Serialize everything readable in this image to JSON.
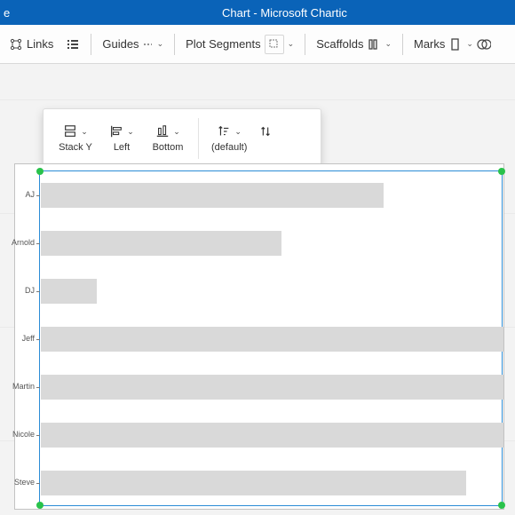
{
  "titlebar": {
    "left_fragment": "e",
    "title": "Chart - Microsoft Chartic"
  },
  "toolbar": {
    "links": "Links",
    "guides": "Guides",
    "plot_segments": "Plot Segments",
    "scaffolds": "Scaffolds",
    "marks": "Marks"
  },
  "panel": {
    "stack_y": "Stack Y",
    "left": "Left",
    "bottom": "Bottom",
    "default": "(default)"
  },
  "chart_data": {
    "type": "bar",
    "orientation": "horizontal",
    "title": "",
    "xlabel": "",
    "ylabel": "",
    "xlim": [
      0,
      100
    ],
    "categories": [
      "AJ",
      "Arnold",
      "DJ",
      "Jeff",
      "Martin",
      "Nicole",
      "Steve"
    ],
    "values": [
      74,
      52,
      12,
      100,
      100,
      100,
      92
    ]
  },
  "colors": {
    "brand": "#0A63B8",
    "selection": "#2b8cd6",
    "handle": "#29c24b",
    "bar": "#d9d9d9"
  }
}
